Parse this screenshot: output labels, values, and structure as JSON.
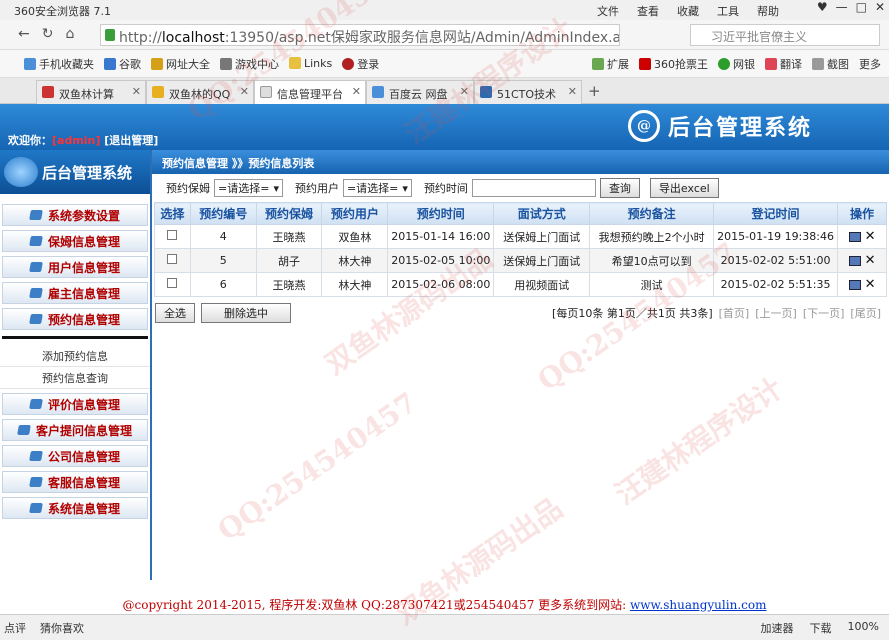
{
  "browser": {
    "title": "360安全浏览器 7.1",
    "menu": [
      "文件",
      "查看",
      "收藏",
      "工具",
      "帮助"
    ],
    "url_prefix": "http://",
    "url_host": "localhost",
    "url_rest": ":13950/asp.net保姆家政服务信息网站/Admin/AdminIndex.aspx",
    "search_placeholder": "习近平批官僚主义",
    "bookmarks_left": [
      "手机收藏夹",
      "谷歌",
      "网址大全",
      "游戏中心",
      "Links",
      "登录"
    ],
    "bookmarks_right": [
      "扩展",
      "360抢票王",
      "网银",
      "翻译",
      "截图",
      "更多"
    ],
    "tabs": [
      "双鱼林计算",
      "双鱼林的QQ",
      "信息管理平台",
      "百度云 网盘",
      "51CTO技术"
    ]
  },
  "header": {
    "welcome": "欢迎你：",
    "user": "[admin]",
    "logout": "[退出管理]",
    "logo_glyph": "@",
    "logo_text": "后台管理系统"
  },
  "sidebar": {
    "brand": "后台管理系统",
    "items": [
      "系统参数设置",
      "保姆信息管理",
      "用户信息管理",
      "雇主信息管理",
      "预约信息管理"
    ],
    "subitems": [
      "添加预约信息",
      "预约信息查询"
    ],
    "items2": [
      "评价信息管理",
      "客户提问信息管理",
      "公司信息管理",
      "客服信息管理",
      "系统信息管理"
    ]
  },
  "main": {
    "crumb": "预约信息管理 》》预约信息列表",
    "filter": {
      "nanny_label": "预约保姆",
      "nanny_value": "=请选择=",
      "user_label": "预约用户",
      "user_value": "=请选择=",
      "time_label": "预约时间",
      "query": "查询",
      "export": "导出excel"
    },
    "columns": [
      "选择",
      "预约编号",
      "预约保姆",
      "预约用户",
      "预约时间",
      "面试方式",
      "预约备注",
      "登记时间",
      "操作"
    ],
    "rows": [
      [
        "4",
        "王晓燕",
        "双鱼林",
        "2015-01-14 16:00",
        "送保姆上门面试",
        "我想预约晚上2个小时",
        "2015-01-19 19:38:46"
      ],
      [
        "5",
        "胡子",
        "林大神",
        "2015-02-05 10:00",
        "送保姆上门面试",
        "希望10点可以到",
        "2015-02-02 5:51:00"
      ],
      [
        "6",
        "王晓燕",
        "林大神",
        "2015-02-06 08:00",
        "用视频面试",
        "测试",
        "2015-02-02 5:51:35"
      ]
    ],
    "select_all": "全选",
    "delete_selected": "删除选中",
    "pager": {
      "info": "[每页10条 第1页／共1页 共3条]",
      "first": "[首页]",
      "prev": "[上一页]",
      "next": "[下一页]",
      "last": "[尾页]"
    }
  },
  "footer": {
    "text": "@copyright 2014-2015, 程序开发:双鱼林  QQ:287307421或254540457  更多系统到网站:",
    "link": "www.shuangyulin.com"
  },
  "statusbar": {
    "left1": "点评",
    "left2": "猜你喜欢",
    "right": [
      "加速器",
      "下载",
      "100%"
    ]
  },
  "watermarks": [
    "QQ:254540457",
    "双鱼林源码出品",
    "汪建林程序设计",
    "QQ:254540457",
    "双鱼林源码出品",
    "QQ:254540457",
    "汪建林程序设计"
  ]
}
